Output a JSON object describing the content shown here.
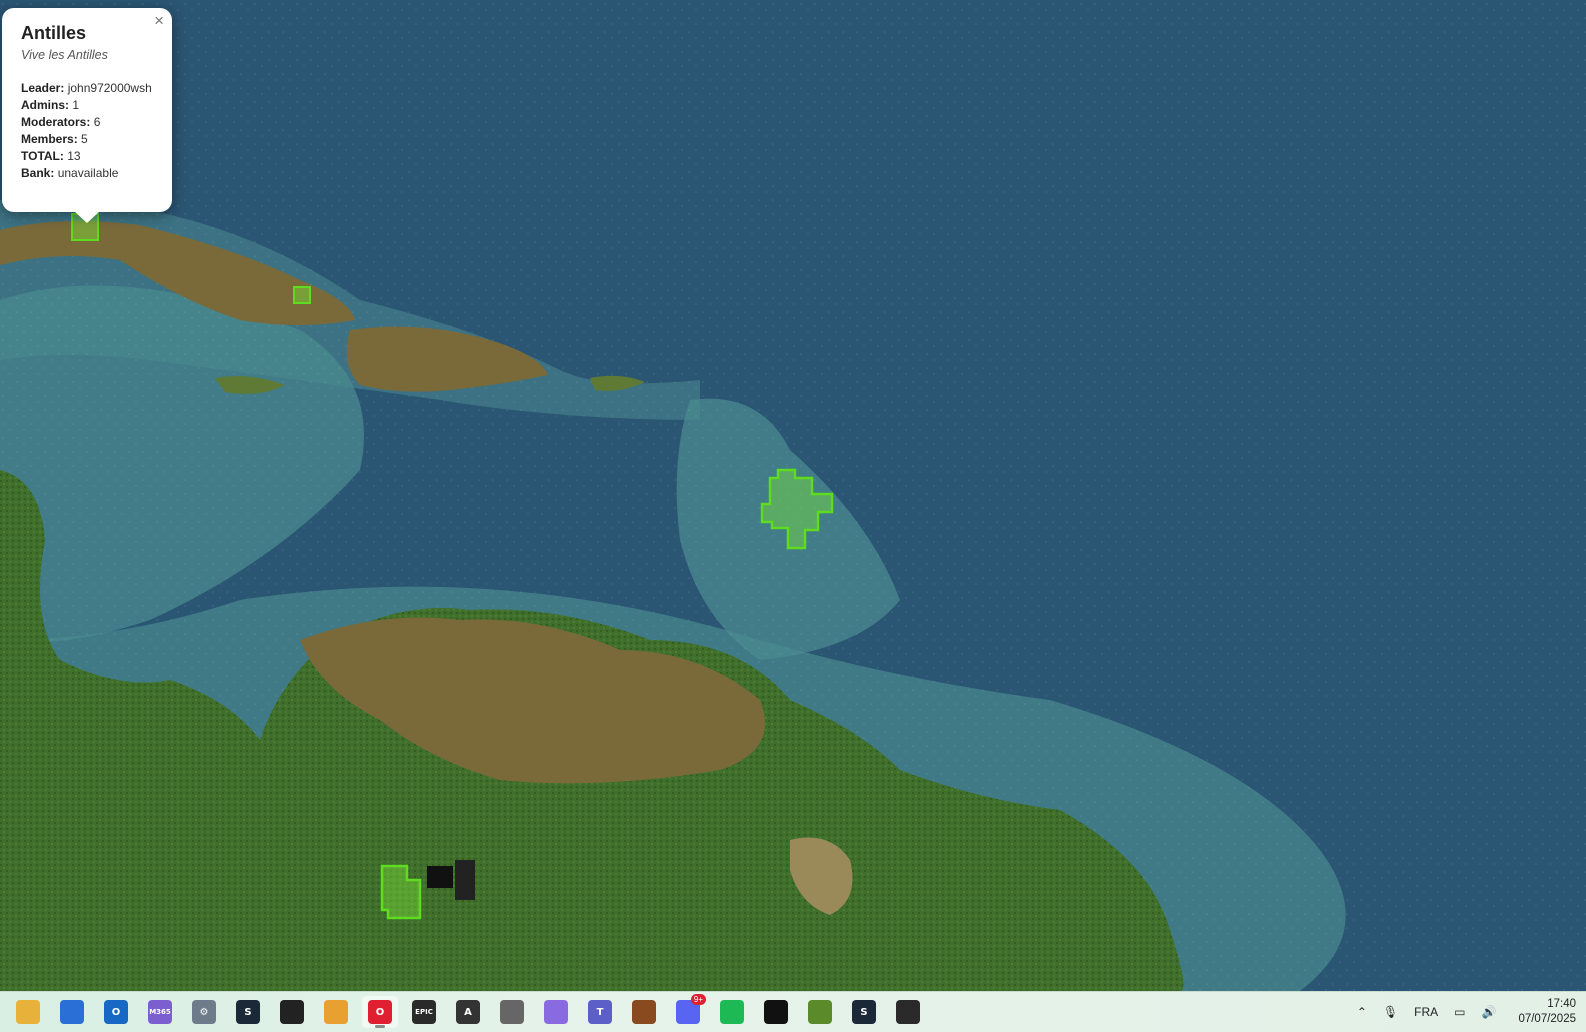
{
  "popup": {
    "title": "Antilles",
    "motto": "Vive les Antilles",
    "close_symbol": "×",
    "fields": [
      {
        "label": "Leader:",
        "value": "john972000wsh"
      },
      {
        "label": "Admins:",
        "value": "1"
      },
      {
        "label": "Moderators:",
        "value": "6"
      },
      {
        "label": "Members:",
        "value": "5"
      },
      {
        "label": "TOTAL:",
        "value": "13"
      },
      {
        "label": "Bank:",
        "value": "unavailable"
      }
    ]
  },
  "colors": {
    "ocean_deep": "#2a5573",
    "ocean_shallow": "#4a8a8f",
    "land_green": "#3d6f2a",
    "land_brown": "#7a6a3a",
    "claim_fill": "#7be03a",
    "claim_border": "#5fdc1f"
  },
  "taskbar": {
    "apps": [
      {
        "name": "file-explorer-icon",
        "label": "",
        "color": "#e8b23a"
      },
      {
        "name": "microsoft-store-icon",
        "label": "",
        "color": "#2a6fd6"
      },
      {
        "name": "outlook-icon",
        "label": "O",
        "color": "#1668c4"
      },
      {
        "name": "m365-icon",
        "label": "M365",
        "color": "#7b5fd0"
      },
      {
        "name": "settings-icon",
        "label": "⚙",
        "color": "#6d7b8a"
      },
      {
        "name": "steam-icon",
        "label": "S",
        "color": "#1b2838"
      },
      {
        "name": "app-icon",
        "label": "",
        "color": "#222222"
      },
      {
        "name": "app-icon",
        "label": "",
        "color": "#e8a030"
      },
      {
        "name": "opera-icon",
        "label": "O",
        "color": "#e02030"
      },
      {
        "name": "epic-games-icon",
        "label": "EPIC",
        "color": "#2a2a2a"
      },
      {
        "name": "app-icon",
        "label": "A",
        "color": "#333333"
      },
      {
        "name": "gamepad-icon",
        "label": "",
        "color": "#666666"
      },
      {
        "name": "app-icon",
        "label": "",
        "color": "#8a6ae0"
      },
      {
        "name": "teams-icon",
        "label": "T",
        "color": "#5b5fc7"
      },
      {
        "name": "game-icon",
        "label": "",
        "color": "#8a4a20"
      },
      {
        "name": "discord-icon",
        "label": "",
        "color": "#5865f2",
        "badge": "9+"
      },
      {
        "name": "spotify-icon",
        "label": "",
        "color": "#1db954"
      },
      {
        "name": "app-icon",
        "label": "",
        "color": "#111111"
      },
      {
        "name": "minecraft-icon",
        "label": "",
        "color": "#5a8a2a"
      },
      {
        "name": "steam-icon",
        "label": "S",
        "color": "#1b2838"
      },
      {
        "name": "obs-icon",
        "label": "",
        "color": "#2a2a2a"
      }
    ],
    "active_index": 8,
    "tray": {
      "language": "FRA",
      "time": "17:40",
      "date": "07/07/2025"
    }
  }
}
